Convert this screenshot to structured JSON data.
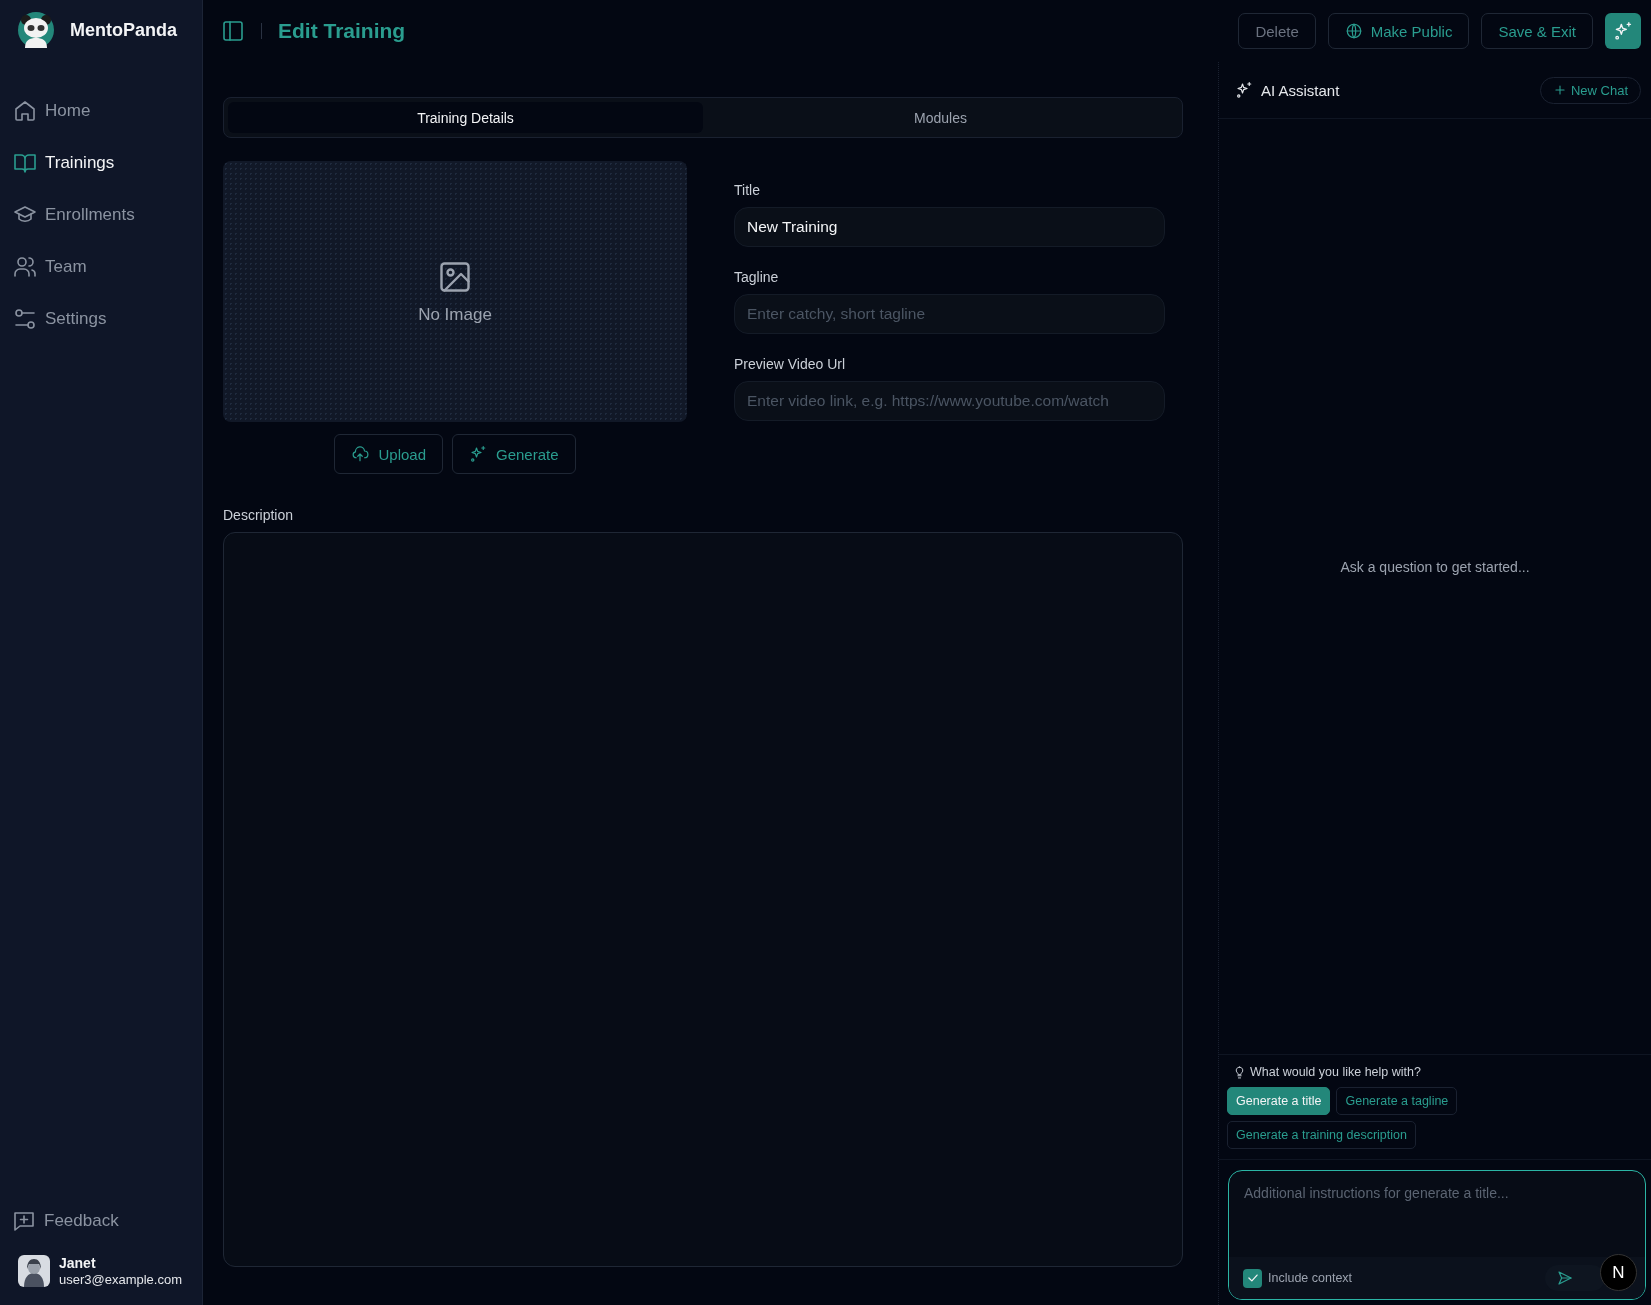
{
  "brand": {
    "name": "MentoPanda"
  },
  "nav": [
    {
      "label": "Home",
      "kind": "home",
      "selected": false
    },
    {
      "label": "Trainings",
      "kind": "book",
      "selected": true
    },
    {
      "label": "Enrollments",
      "kind": "cap",
      "selected": false
    },
    {
      "label": "Team",
      "kind": "users",
      "selected": false
    },
    {
      "label": "Settings",
      "kind": "sliders",
      "selected": false
    }
  ],
  "feedback": {
    "label": "Feedback"
  },
  "user": {
    "name": "Janet",
    "email": "user3@example.com"
  },
  "header": {
    "title": "Edit Training",
    "actions": [
      {
        "label": "Delete",
        "kind": "muted"
      },
      {
        "label": "Make Public",
        "kind": "globe"
      },
      {
        "label": "Save & Exit",
        "kind": "plain"
      }
    ]
  },
  "tabs": [
    {
      "label": "Training Details",
      "selected": true
    },
    {
      "label": "Modules",
      "selected": false
    }
  ],
  "image": {
    "empty_text": "No Image",
    "buttons": [
      {
        "label": "Upload",
        "kind": "upload"
      },
      {
        "label": "Generate",
        "kind": "sparkle"
      }
    ]
  },
  "fields": [
    {
      "label": "Title",
      "value": "New Training"
    },
    {
      "label": "Tagline",
      "placeholder": "Enter catchy, short tagline"
    },
    {
      "label": "Preview Video Url",
      "placeholder": "Enter video link, e.g. https://www.youtube.com/watch"
    }
  ],
  "description": {
    "label": "Description"
  },
  "assistant": {
    "title": "AI Assistant",
    "new_chat": "New Chat",
    "empty_text": "Ask a question to get started...",
    "help_prompt": "What would you like help with?",
    "suggestions": [
      {
        "label": "Generate a title",
        "selected": true
      },
      {
        "label": "Generate a tagline",
        "selected": false
      },
      {
        "label": "Generate a training description",
        "selected": false
      }
    ],
    "input_placeholder": "Additional instructions for generate a title...",
    "include_context": {
      "label": "Include context",
      "checked": true
    }
  },
  "dev_badge": {
    "text": "N"
  }
}
